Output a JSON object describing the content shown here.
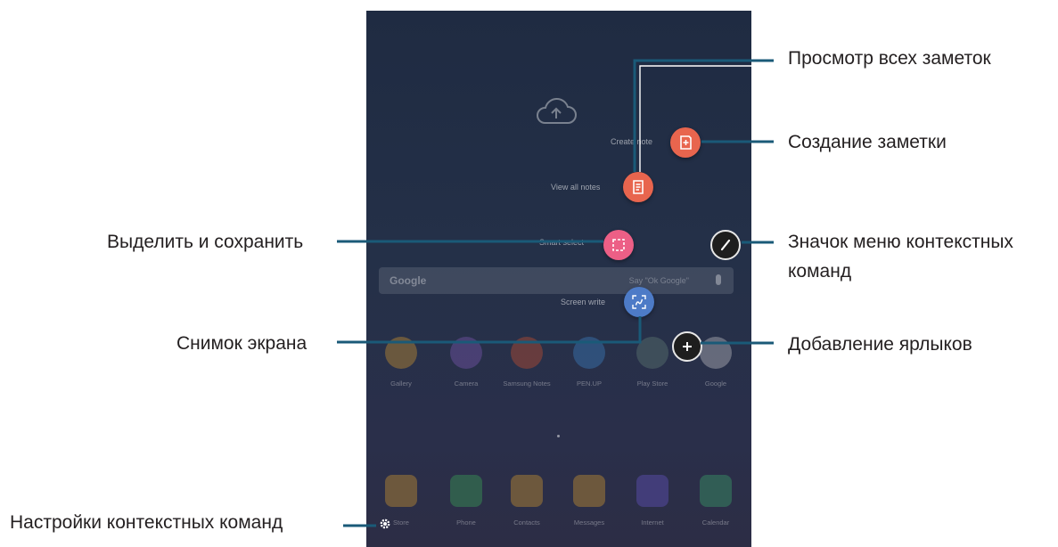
{
  "callouts": {
    "view_all_notes": "Просмотр всех заметок",
    "create_note": "Создание заметки",
    "air_command_icon_line1": "Значок меню контекстных",
    "air_command_icon_line2": "команд",
    "add_shortcuts": "Добавление ярлыков",
    "smart_select": "Выделить и сохранить",
    "screen_write": "Снимок экрана",
    "air_command_settings": "Настройки контекстных команд"
  },
  "menu": {
    "create_note": "Create note",
    "view_all_notes": "View all notes",
    "smart_select": "Smart select",
    "screen_write": "Screen write"
  },
  "search": {
    "brand": "Google",
    "hint": "Say \"Ok Google\""
  },
  "apps_row": [
    {
      "label": "Gallery",
      "color": "#e7a72a"
    },
    {
      "label": "Camera",
      "color": "#8a5ec4"
    },
    {
      "label": "Samsung Notes",
      "color": "#e0552a"
    },
    {
      "label": "PEN.UP",
      "color": "#3f8fd6"
    },
    {
      "label": "Play Store",
      "color": "#6a8a7a"
    },
    {
      "label": "Google",
      "color": "#d9d9d9"
    }
  ],
  "dock": [
    {
      "label": "Store",
      "color": "#e7a72a"
    },
    {
      "label": "Phone",
      "color": "#3bb55a"
    },
    {
      "label": "Contacts",
      "color": "#e7a72a"
    },
    {
      "label": "Messages",
      "color": "#e7a72a"
    },
    {
      "label": "Internet",
      "color": "#6c5ad6"
    },
    {
      "label": "Calendar",
      "color": "#3bb570"
    }
  ],
  "colors": {
    "orange": "#e8654e",
    "pink": "#ec5f86",
    "blue": "#4d7bc7",
    "leader": "#1a5a78"
  }
}
